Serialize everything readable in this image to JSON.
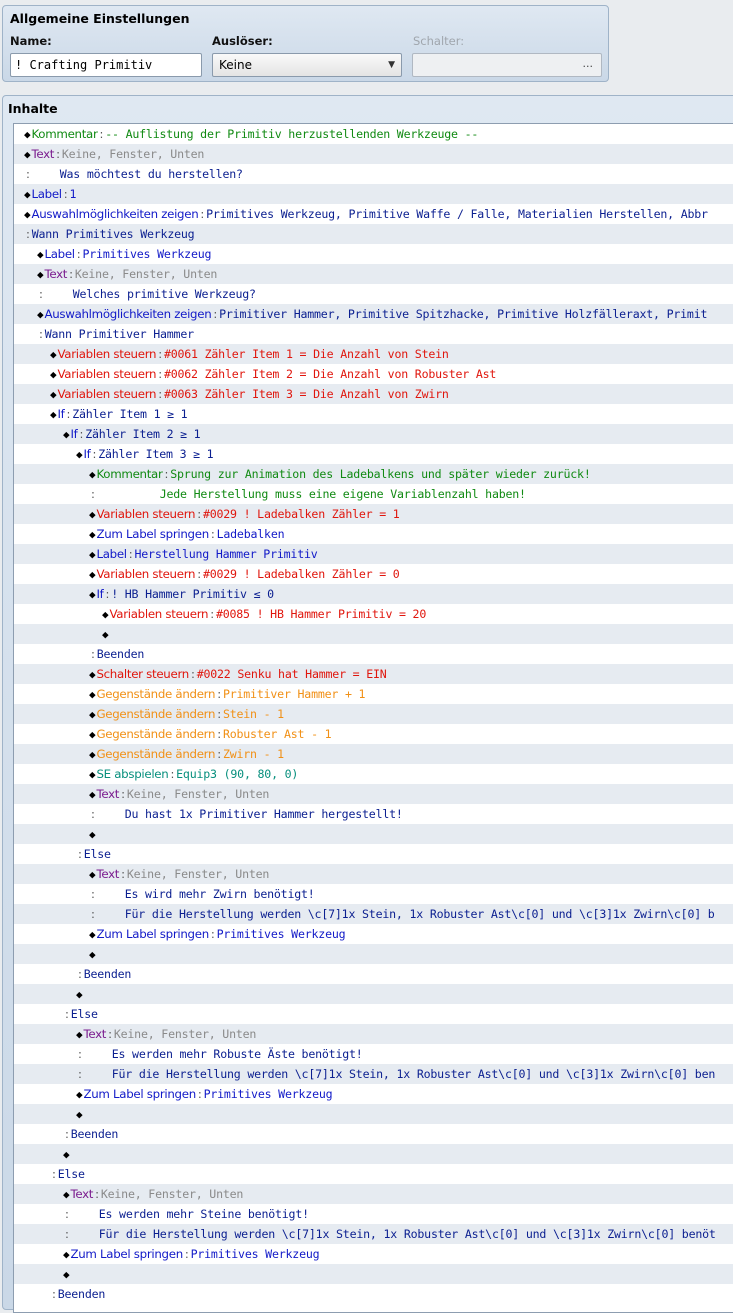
{
  "general": {
    "title": "Allgemeine Einstellungen",
    "name_label": "Name:",
    "name_value": "! Crafting Primitiv",
    "trigger_label": "Auslöser:",
    "trigger_value": "Keine",
    "switch_label": "Schalter:",
    "switch_button": "..."
  },
  "contents": {
    "title": "Inhalte",
    "rows": [
      {
        "indent": 0,
        "diamond": true,
        "kw": "Kommentar",
        "kwc": "c-green",
        "sep": ":",
        "arg": "-- Auflistung der Primitiv herzustellenden Werkzeuge --",
        "argc": "c-green"
      },
      {
        "indent": 0,
        "diamond": true,
        "kw": "Text",
        "kwc": "c-purple",
        "sep": ":",
        "arg": "Keine, Fenster, Unten",
        "argc": "c-gray"
      },
      {
        "indent": 0,
        "diamond": false,
        "kw": "",
        "kwc": "",
        "sep": ":",
        "pad": 4,
        "arg": "Was möchtest du herstellen?",
        "argc": "c-navy"
      },
      {
        "indent": 0,
        "diamond": true,
        "kw": "Label",
        "kwc": "c-blue",
        "sep": ":",
        "arg": "1",
        "argc": "c-blue"
      },
      {
        "indent": 0,
        "diamond": true,
        "kw": "Auswahlmöglichkeiten zeigen",
        "kwc": "c-blue",
        "sep": ":",
        "arg": "Primitives Werkzeug, Primitive Waffe / Falle, Materialien Herstellen, Abbr",
        "argc": "c-navy"
      },
      {
        "indent": 0,
        "diamond": false,
        "kw": "",
        "kwc": "",
        "sep": ":",
        "pad": 0,
        "arg": "Wann Primitives Werkzeug",
        "argc": "c-navy"
      },
      {
        "indent": 1,
        "diamond": true,
        "kw": "Label",
        "kwc": "c-blue",
        "sep": ":",
        "arg": "Primitives Werkzeug",
        "argc": "c-blue"
      },
      {
        "indent": 1,
        "diamond": true,
        "kw": "Text",
        "kwc": "c-purple",
        "sep": ":",
        "arg": "Keine, Fenster, Unten",
        "argc": "c-gray"
      },
      {
        "indent": 1,
        "diamond": false,
        "kw": "",
        "kwc": "",
        "sep": ":",
        "pad": 4,
        "arg": "Welches primitive Werkzeug?",
        "argc": "c-navy"
      },
      {
        "indent": 1,
        "diamond": true,
        "kw": "Auswahlmöglichkeiten zeigen",
        "kwc": "c-blue",
        "sep": ":",
        "arg": "Primitiver Hammer, Primitive Spitzhacke, Primitive Holzfälleraxt, Primit",
        "argc": "c-navy"
      },
      {
        "indent": 1,
        "diamond": false,
        "kw": "",
        "kwc": "",
        "sep": ":",
        "pad": 0,
        "arg": "Wann Primitiver Hammer",
        "argc": "c-navy"
      },
      {
        "indent": 2,
        "diamond": true,
        "kw": "Variablen steuern",
        "kwc": "c-red",
        "sep": ":",
        "arg": "#0061 Zähler Item 1 = Die Anzahl von Stein",
        "argc": "c-red"
      },
      {
        "indent": 2,
        "diamond": true,
        "kw": "Variablen steuern",
        "kwc": "c-red",
        "sep": ":",
        "arg": "#0062 Zähler Item 2 = Die Anzahl von Robuster Ast",
        "argc": "c-red"
      },
      {
        "indent": 2,
        "diamond": true,
        "kw": "Variablen steuern",
        "kwc": "c-red",
        "sep": ":",
        "arg": "#0063 Zähler Item 3 = Die Anzahl von Zwirn",
        "argc": "c-red"
      },
      {
        "indent": 2,
        "diamond": true,
        "kw": "If",
        "kwc": "c-blue",
        "sep": ":",
        "arg": "Zähler Item 1 ≥ 1",
        "argc": "c-navy"
      },
      {
        "indent": 3,
        "diamond": true,
        "kw": "If",
        "kwc": "c-blue",
        "sep": ":",
        "arg": "Zähler Item 2 ≥ 1",
        "argc": "c-navy"
      },
      {
        "indent": 4,
        "diamond": true,
        "kw": "If",
        "kwc": "c-blue",
        "sep": ":",
        "arg": "Zähler Item 3 ≥ 1",
        "argc": "c-navy"
      },
      {
        "indent": 5,
        "diamond": true,
        "kw": "Kommentar",
        "kwc": "c-green",
        "sep": ":",
        "arg": "Sprung zur Animation des Ladebalkens und später wieder zurück!",
        "argc": "c-green"
      },
      {
        "indent": 5,
        "diamond": false,
        "kw": "",
        "kwc": "",
        "sep": ":",
        "pad": 9,
        "arg": "Jede Herstellung muss eine eigene Variablenzahl haben!",
        "argc": "c-green"
      },
      {
        "indent": 5,
        "diamond": true,
        "kw": "Variablen steuern",
        "kwc": "c-red",
        "sep": ":",
        "arg": "#0029 ! Ladebalken Zähler = 1",
        "argc": "c-red"
      },
      {
        "indent": 5,
        "diamond": true,
        "kw": "Zum Label springen",
        "kwc": "c-blue",
        "sep": ":",
        "arg": "Ladebalken",
        "argc": "c-blue"
      },
      {
        "indent": 5,
        "diamond": true,
        "kw": "Label",
        "kwc": "c-blue",
        "sep": ":",
        "arg": "Herstellung Hammer Primitiv",
        "argc": "c-blue"
      },
      {
        "indent": 5,
        "diamond": true,
        "kw": "Variablen steuern",
        "kwc": "c-red",
        "sep": ":",
        "arg": "#0029 ! Ladebalken Zähler = 0",
        "argc": "c-red"
      },
      {
        "indent": 5,
        "diamond": true,
        "kw": "If",
        "kwc": "c-blue",
        "sep": ":",
        "arg": "! HB Hammer Primitiv ≤ 0",
        "argc": "c-navy"
      },
      {
        "indent": 6,
        "diamond": true,
        "kw": "Variablen steuern",
        "kwc": "c-red",
        "sep": ":",
        "arg": "#0085 ! HB Hammer Primitiv = 20",
        "argc": "c-red"
      },
      {
        "indent": 6,
        "diamond": true,
        "kw": "",
        "kwc": "",
        "sep": "",
        "arg": "",
        "argc": ""
      },
      {
        "indent": 5,
        "diamond": false,
        "kw": "",
        "kwc": "",
        "sep": ":",
        "pad": 0,
        "arg": "Beenden",
        "argc": "c-navy"
      },
      {
        "indent": 5,
        "diamond": true,
        "kw": "Schalter steuern",
        "kwc": "c-red",
        "sep": ":",
        "arg": "#0022 Senku hat Hammer = EIN",
        "argc": "c-red"
      },
      {
        "indent": 5,
        "diamond": true,
        "kw": "Gegenstände ändern",
        "kwc": "c-orange",
        "sep": ":",
        "arg": "Primitiver Hammer + 1",
        "argc": "c-orange"
      },
      {
        "indent": 5,
        "diamond": true,
        "kw": "Gegenstände ändern",
        "kwc": "c-orange",
        "sep": ":",
        "arg": "Stein - 1",
        "argc": "c-orange"
      },
      {
        "indent": 5,
        "diamond": true,
        "kw": "Gegenstände ändern",
        "kwc": "c-orange",
        "sep": ":",
        "arg": "Robuster Ast - 1",
        "argc": "c-orange"
      },
      {
        "indent": 5,
        "diamond": true,
        "kw": "Gegenstände ändern",
        "kwc": "c-orange",
        "sep": ":",
        "arg": "Zwirn - 1",
        "argc": "c-orange"
      },
      {
        "indent": 5,
        "diamond": true,
        "kw": "SE abspielen",
        "kwc": "c-teal",
        "sep": ":",
        "arg": "Equip3 (90, 80, 0)",
        "argc": "c-teal"
      },
      {
        "indent": 5,
        "diamond": true,
        "kw": "Text",
        "kwc": "c-purple",
        "sep": ":",
        "arg": "Keine, Fenster, Unten",
        "argc": "c-gray"
      },
      {
        "indent": 5,
        "diamond": false,
        "kw": "",
        "kwc": "",
        "sep": ":",
        "pad": 4,
        "arg": "Du hast 1x Primitiver Hammer hergestellt!",
        "argc": "c-navy"
      },
      {
        "indent": 5,
        "diamond": true,
        "kw": "",
        "kwc": "",
        "sep": "",
        "arg": "",
        "argc": ""
      },
      {
        "indent": 4,
        "diamond": false,
        "kw": "",
        "kwc": "",
        "sep": ":",
        "pad": 0,
        "arg": "Else",
        "argc": "c-navy"
      },
      {
        "indent": 5,
        "diamond": true,
        "kw": "Text",
        "kwc": "c-purple",
        "sep": ":",
        "arg": "Keine, Fenster, Unten",
        "argc": "c-gray"
      },
      {
        "indent": 5,
        "diamond": false,
        "kw": "",
        "kwc": "",
        "sep": ":",
        "pad": 4,
        "arg": "Es wird mehr Zwirn benötigt!",
        "argc": "c-navy"
      },
      {
        "indent": 5,
        "diamond": false,
        "kw": "",
        "kwc": "",
        "sep": ":",
        "pad": 4,
        "arg": "Für die Herstellung werden \\c[7]1x Stein, 1x Robuster Ast\\c[0] und \\c[3]1x Zwirn\\c[0] b",
        "argc": "c-navy"
      },
      {
        "indent": 5,
        "diamond": true,
        "kw": "Zum Label springen",
        "kwc": "c-blue",
        "sep": ":",
        "arg": "Primitives Werkzeug",
        "argc": "c-blue"
      },
      {
        "indent": 5,
        "diamond": true,
        "kw": "",
        "kwc": "",
        "sep": "",
        "arg": "",
        "argc": ""
      },
      {
        "indent": 4,
        "diamond": false,
        "kw": "",
        "kwc": "",
        "sep": ":",
        "pad": 0,
        "arg": "Beenden",
        "argc": "c-navy"
      },
      {
        "indent": 4,
        "diamond": true,
        "kw": "",
        "kwc": "",
        "sep": "",
        "arg": "",
        "argc": ""
      },
      {
        "indent": 3,
        "diamond": false,
        "kw": "",
        "kwc": "",
        "sep": ":",
        "pad": 0,
        "arg": "Else",
        "argc": "c-navy"
      },
      {
        "indent": 4,
        "diamond": true,
        "kw": "Text",
        "kwc": "c-purple",
        "sep": ":",
        "arg": "Keine, Fenster, Unten",
        "argc": "c-gray"
      },
      {
        "indent": 4,
        "diamond": false,
        "kw": "",
        "kwc": "",
        "sep": ":",
        "pad": 4,
        "arg": "Es werden mehr Robuste Äste benötigt!",
        "argc": "c-navy"
      },
      {
        "indent": 4,
        "diamond": false,
        "kw": "",
        "kwc": "",
        "sep": ":",
        "pad": 4,
        "arg": "Für die Herstellung werden \\c[7]1x Stein, 1x Robuster Ast\\c[0] und \\c[3]1x Zwirn\\c[0] ben",
        "argc": "c-navy"
      },
      {
        "indent": 4,
        "diamond": true,
        "kw": "Zum Label springen",
        "kwc": "c-blue",
        "sep": ":",
        "arg": "Primitives Werkzeug",
        "argc": "c-blue"
      },
      {
        "indent": 4,
        "diamond": true,
        "kw": "",
        "kwc": "",
        "sep": "",
        "arg": "",
        "argc": ""
      },
      {
        "indent": 3,
        "diamond": false,
        "kw": "",
        "kwc": "",
        "sep": ":",
        "pad": 0,
        "arg": "Beenden",
        "argc": "c-navy"
      },
      {
        "indent": 3,
        "diamond": true,
        "kw": "",
        "kwc": "",
        "sep": "",
        "arg": "",
        "argc": ""
      },
      {
        "indent": 2,
        "diamond": false,
        "kw": "",
        "kwc": "",
        "sep": ":",
        "pad": 0,
        "arg": "Else",
        "argc": "c-navy"
      },
      {
        "indent": 3,
        "diamond": true,
        "kw": "Text",
        "kwc": "c-purple",
        "sep": ":",
        "arg": "Keine, Fenster, Unten",
        "argc": "c-gray"
      },
      {
        "indent": 3,
        "diamond": false,
        "kw": "",
        "kwc": "",
        "sep": ":",
        "pad": 4,
        "arg": "Es werden mehr Steine benötigt!",
        "argc": "c-navy"
      },
      {
        "indent": 3,
        "diamond": false,
        "kw": "",
        "kwc": "",
        "sep": ":",
        "pad": 4,
        "arg": "Für die Herstellung werden \\c[7]1x Stein, 1x Robuster Ast\\c[0] und \\c[3]1x Zwirn\\c[0] benöt",
        "argc": "c-navy"
      },
      {
        "indent": 3,
        "diamond": true,
        "kw": "Zum Label springen",
        "kwc": "c-blue",
        "sep": ":",
        "arg": "Primitives Werkzeug",
        "argc": "c-blue"
      },
      {
        "indent": 3,
        "diamond": true,
        "kw": "",
        "kwc": "",
        "sep": "",
        "arg": "",
        "argc": ""
      },
      {
        "indent": 2,
        "diamond": false,
        "kw": "",
        "kwc": "",
        "sep": ":",
        "pad": 0,
        "arg": "Beenden",
        "argc": "c-navy"
      }
    ]
  }
}
